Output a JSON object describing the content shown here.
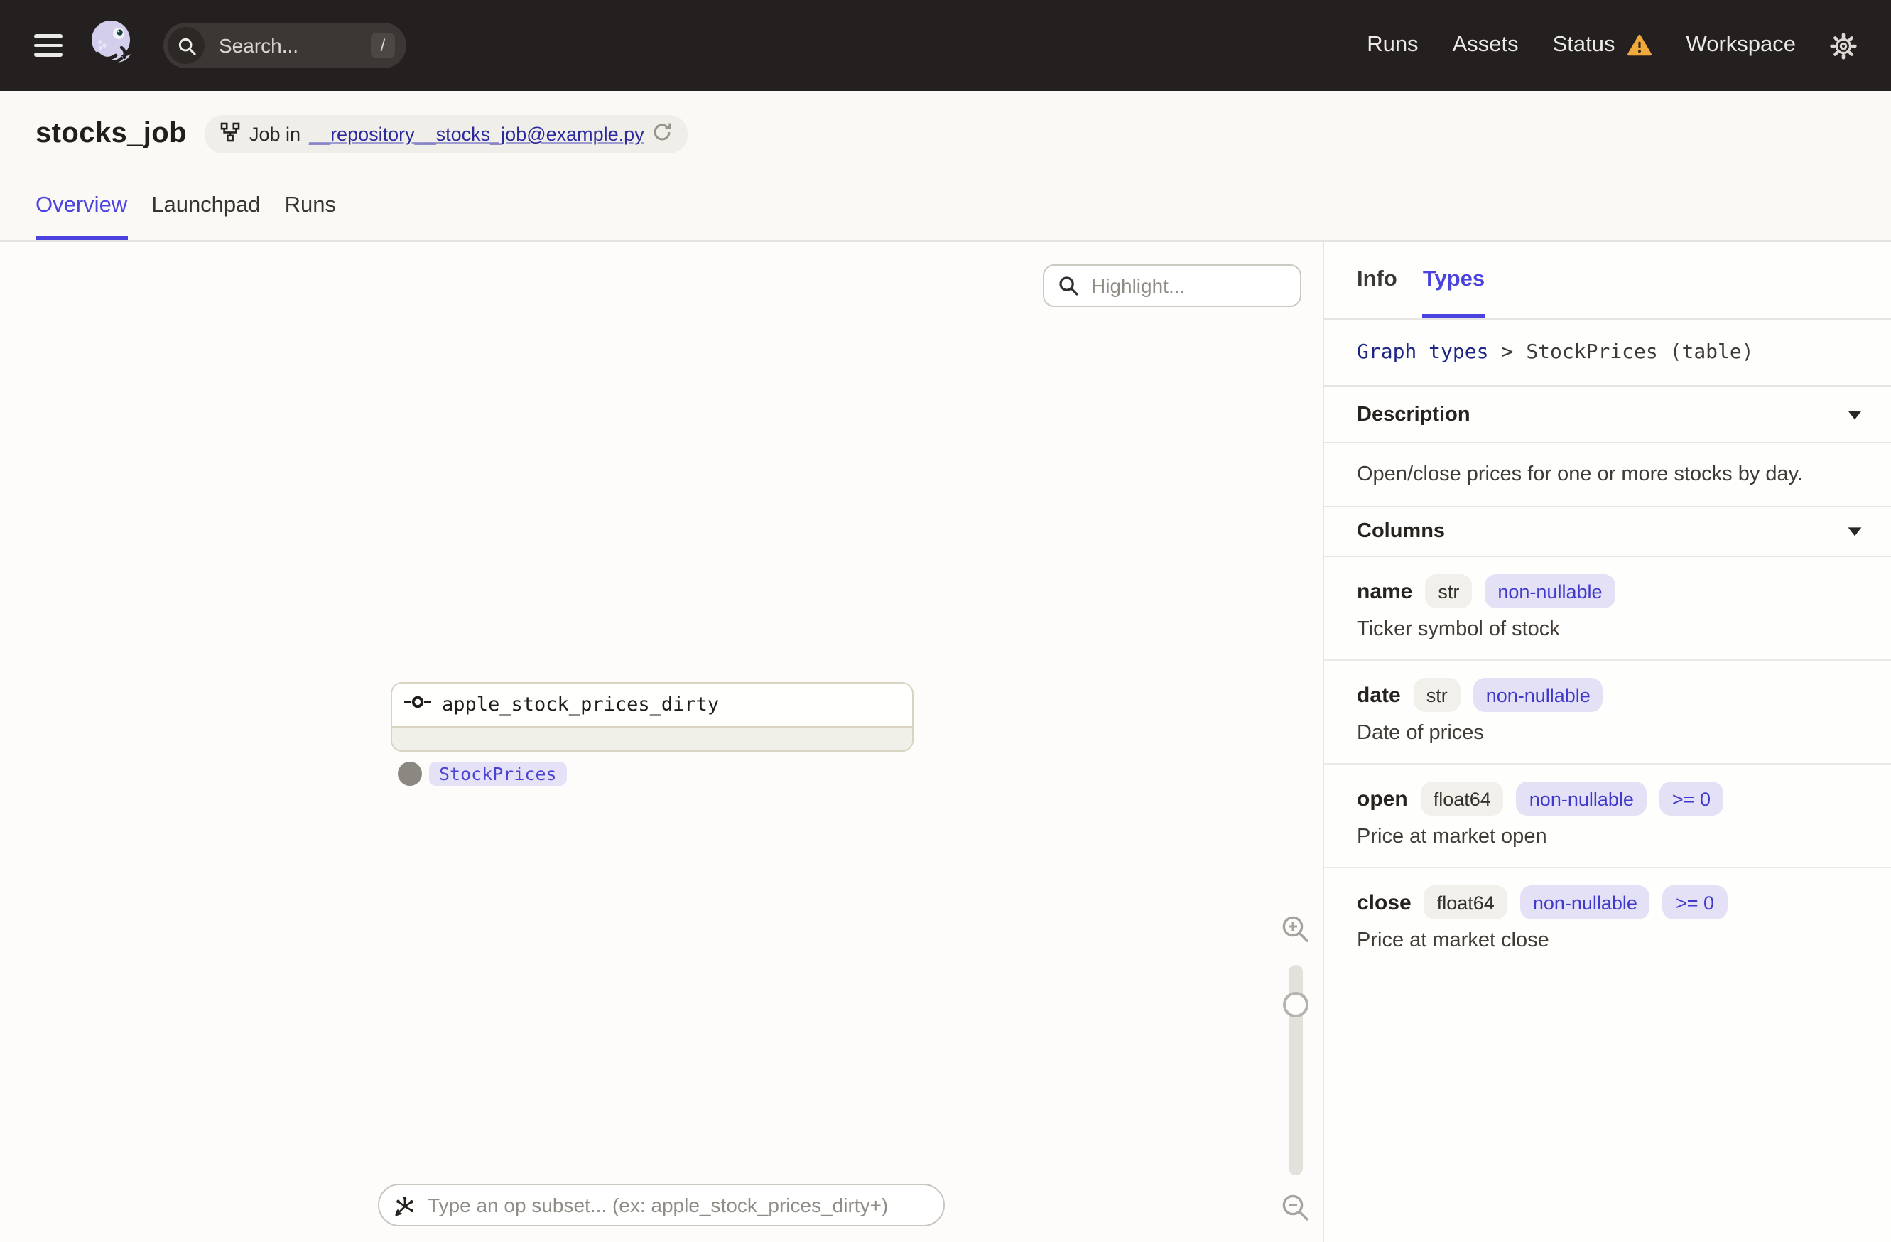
{
  "nav": {
    "search_placeholder": "Search...",
    "search_shortcut": "/",
    "links": [
      {
        "label": "Runs"
      },
      {
        "label": "Assets"
      },
      {
        "label": "Status",
        "warning": true
      },
      {
        "label": "Workspace"
      }
    ]
  },
  "header": {
    "title": "stocks_job",
    "job_pill": {
      "prefix": "Job in",
      "link": "__repository__stocks_job@example.py"
    },
    "tabs": [
      {
        "label": "Overview",
        "active": true
      },
      {
        "label": "Launchpad",
        "active": false
      },
      {
        "label": "Runs",
        "active": false
      }
    ]
  },
  "canvas": {
    "highlight_placeholder": "Highlight...",
    "node": {
      "title": "apple_stock_prices_dirty",
      "output_type_tag": "StockPrices"
    },
    "op_subset_placeholder": "Type an op subset... (ex: apple_stock_prices_dirty+)"
  },
  "panel": {
    "tabs": [
      {
        "label": "Info",
        "active": false
      },
      {
        "label": "Types",
        "active": true
      }
    ],
    "breadcrumb": {
      "link": "Graph types",
      "separator": ">",
      "current": "StockPrices (table)"
    },
    "description_section": {
      "title": "Description",
      "body": "Open/close prices for one or more stocks by day."
    },
    "columns_section": {
      "title": "Columns"
    },
    "columns": [
      {
        "name": "name",
        "type": "str",
        "constraints": [
          "non-nullable"
        ],
        "description": "Ticker symbol of stock"
      },
      {
        "name": "date",
        "type": "str",
        "constraints": [
          "non-nullable"
        ],
        "description": "Date of prices"
      },
      {
        "name": "open",
        "type": "float64",
        "constraints": [
          "non-nullable",
          ">= 0"
        ],
        "description": "Price at market open"
      },
      {
        "name": "close",
        "type": "float64",
        "constraints": [
          "non-nullable",
          ">= 0"
        ],
        "description": "Price at market close"
      }
    ]
  },
  "colors": {
    "accent_indigo": "#4B43E0",
    "nav_background": "#242020",
    "warning_amber": "#F0A93C",
    "link_navy": "#2B2A9D",
    "tag_lavender_bg": "#E5E2F8",
    "tag_lavender_text": "#4B44D3",
    "node_border_tan": "#D9D3C1"
  }
}
